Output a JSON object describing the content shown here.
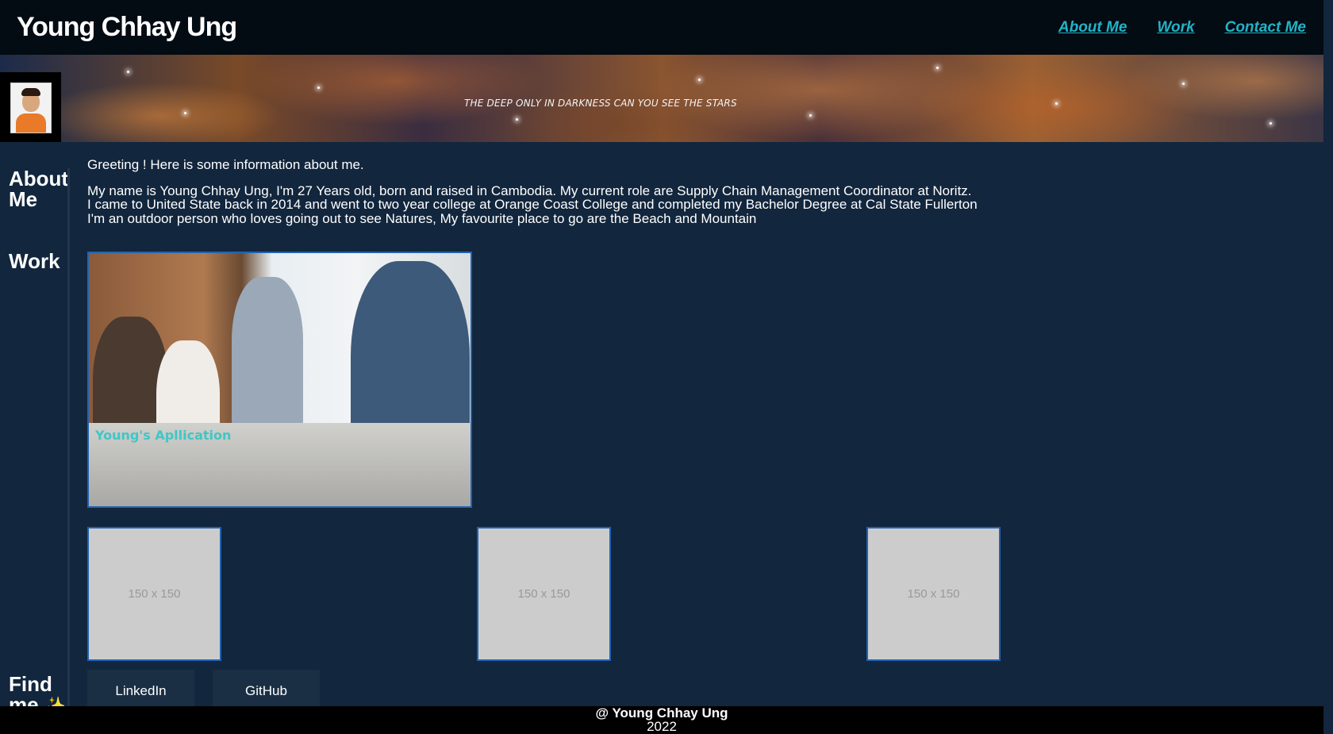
{
  "header": {
    "title": "Young Chhay Ung",
    "nav": [
      "About Me",
      "Work",
      "Contact Me"
    ]
  },
  "banner": {
    "tagline": "THE DEEP ONLY IN DARKNESS CAN YOU SEE THE STARS"
  },
  "about": {
    "label": "About Me",
    "greeting": "Greeting ! Here is some information about me.",
    "lines": [
      "My name is Young Chhay Ung, I'm 27 Years old, born and raised in Cambodia. My current role are Supply Chain Management Coordinator at Noritz.",
      "I came to United State back in 2014 and went to two year college at Orange Coast College and completed my Bachelor Degree at Cal State Fullerton",
      "I'm an outdoor person who loves going out to see Natures, My favourite place to go are the Beach and Mountain"
    ]
  },
  "work": {
    "label": "Work",
    "featured_caption": "Young's Apllication",
    "thumbnails": [
      "150 x 150",
      "150 x 150",
      "150 x 150"
    ]
  },
  "find": {
    "label": "Find me",
    "buttons": [
      "LinkedIn",
      "GitHub"
    ]
  },
  "footer": {
    "owner": "@ Young Chhay Ung",
    "year": "2022"
  },
  "colors": {
    "background": "#12263d",
    "header": "#030b13",
    "link": "#22b3c7",
    "border": "#1f63b3"
  }
}
